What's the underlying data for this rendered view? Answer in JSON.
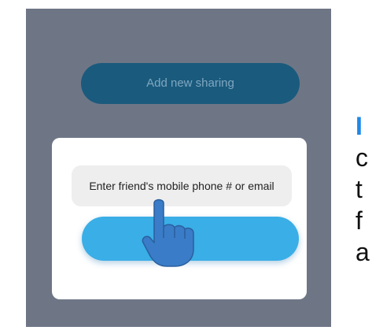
{
  "screen": {
    "add_sharing_button": "Add new sharing"
  },
  "dialog": {
    "input_placeholder": "Enter friend's mobile phone # or email",
    "input_value": "",
    "confirm_button": ""
  },
  "side_text": {
    "lines": [
      "I",
      "c",
      "t",
      "f",
      "a"
    ]
  },
  "colors": {
    "backdrop": "#6e7686",
    "share_button": "#1a5a7d",
    "confirm_button": "#3aaee6",
    "hand": "#3a7cc7"
  },
  "icons": {
    "pointer": "pointing-hand-icon"
  }
}
